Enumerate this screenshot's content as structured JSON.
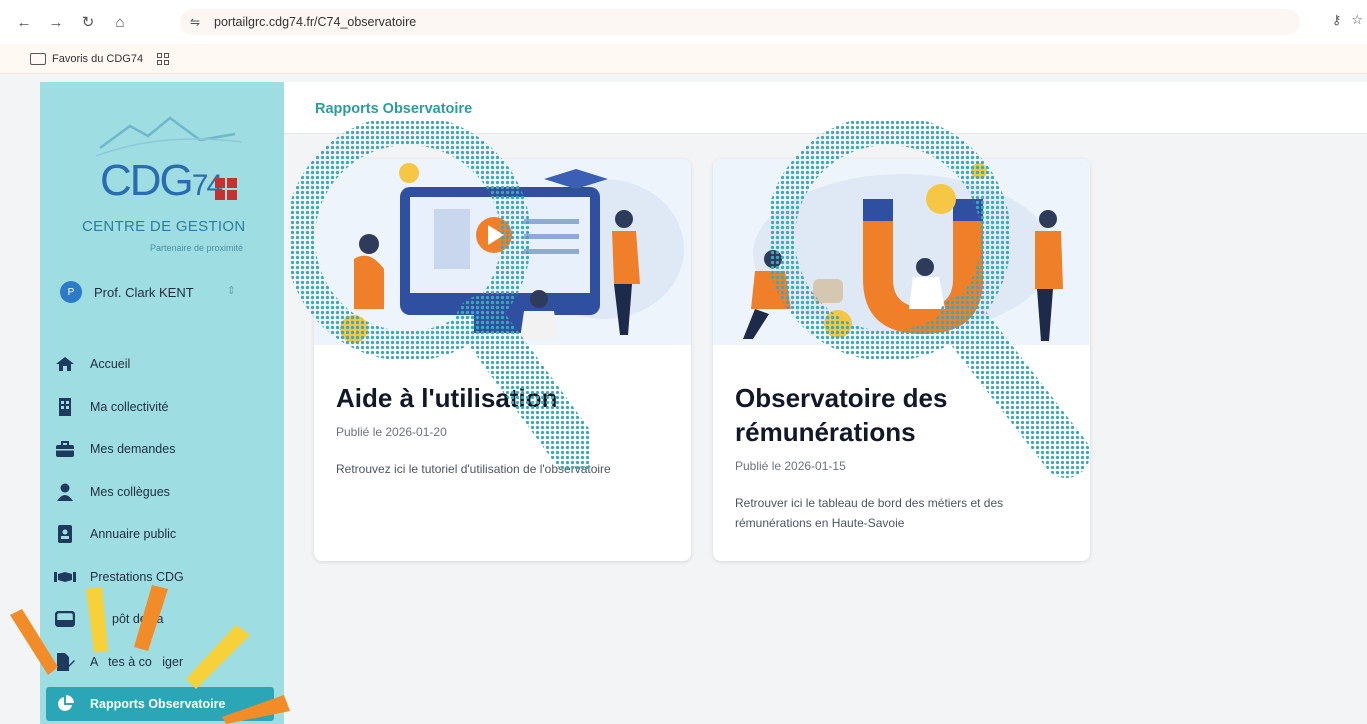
{
  "browser": {
    "url": "portailgrc.cdg74.fr/C74_observatoire",
    "bookmark_label": "Favoris du CDG74"
  },
  "sidebar": {
    "logo_text": "CDG74",
    "logo_title": "CENTRE DE GESTION",
    "logo_subtitle": "Partenaire de proximité",
    "profile": {
      "initial": "P",
      "name": "Prof. Clark KENT"
    },
    "items": [
      {
        "label": "Accueil",
        "icon": "home-icon"
      },
      {
        "label": "Ma collectivité",
        "icon": "building-icon"
      },
      {
        "label": "Mes demandes",
        "icon": "briefcase-icon"
      },
      {
        "label": "Mes collègues",
        "icon": "user-icon"
      },
      {
        "label": "Annuaire public",
        "icon": "contact-book-icon"
      },
      {
        "label": "Prestations CDG",
        "icon": "handshake-icon"
      },
      {
        "label": "pôt des a",
        "icon": "inbox-icon"
      },
      {
        "label": "A   tes à co   iger",
        "icon": "file-edit-icon"
      },
      {
        "label": "Rapports Observatoire",
        "icon": "pie-chart-icon",
        "active": true
      }
    ]
  },
  "main": {
    "page_title": "Rapports Observatoire",
    "cards": [
      {
        "title": "Aide à l'utilisation",
        "date": "Publié le 2026-01-20",
        "description": "Retrouvez ici le tutoriel d'utilisation de l'observatoire"
      },
      {
        "title": "Observatoire des rémunérations",
        "date": "Publié le 2026-01-15",
        "description": "Retrouver ici le tableau de bord des métiers et des rémunérations en Haute-Savoie"
      }
    ]
  },
  "colors": {
    "sidebar_bg": "#9edee3",
    "active_item": "#2aa6b6",
    "accent_title": "#2a9d9f",
    "overlay_orange": "#f28c28",
    "overlay_yellow": "#f6d13a",
    "halftone_teal": "#3aa8b8"
  }
}
